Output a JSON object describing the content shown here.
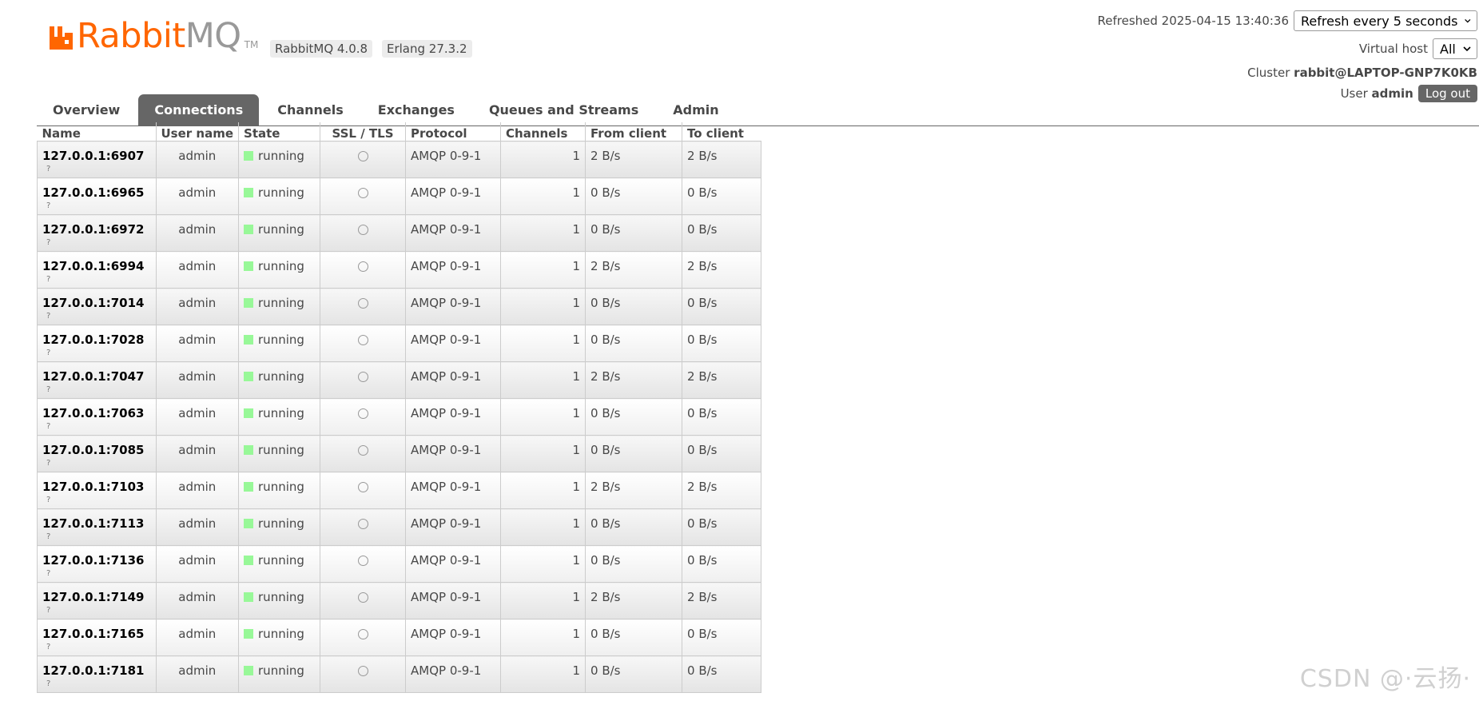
{
  "app": {
    "logo_rabbit": "Rabbit",
    "logo_mq": "MQ",
    "logo_tm": "TM",
    "version": "RabbitMQ 4.0.8",
    "erlang": "Erlang 27.3.2"
  },
  "status": {
    "refreshed": "Refreshed 2025-04-15 13:40:36",
    "refresh_select": "Refresh every 5 seconds",
    "vhost_label": "Virtual host",
    "vhost_select": "All",
    "cluster_label": "Cluster",
    "cluster_name": "rabbit@LAPTOP-GNP7K0KB",
    "user_label": "User",
    "user_name": "admin",
    "logout_label": "Log out"
  },
  "tabs": [
    {
      "label": "Overview",
      "active": false
    },
    {
      "label": "Connections",
      "active": true
    },
    {
      "label": "Channels",
      "active": false
    },
    {
      "label": "Exchanges",
      "active": false
    },
    {
      "label": "Queues and Streams",
      "active": false
    },
    {
      "label": "Admin",
      "active": false
    }
  ],
  "table": {
    "headers": {
      "name": "Name",
      "user": "User name",
      "state": "State",
      "ssl": "SSL / TLS",
      "protocol": "Protocol",
      "channels": "Channels",
      "from_client": "From client",
      "to_client": "To client"
    },
    "rows": [
      {
        "name": "127.0.0.1:6907",
        "sub": "?",
        "user": "admin",
        "state": "running",
        "protocol": "AMQP 0-9-1",
        "channels": "1",
        "from": "2 B/s",
        "to": "2 B/s"
      },
      {
        "name": "127.0.0.1:6965",
        "sub": "?",
        "user": "admin",
        "state": "running",
        "protocol": "AMQP 0-9-1",
        "channels": "1",
        "from": "0 B/s",
        "to": "0 B/s"
      },
      {
        "name": "127.0.0.1:6972",
        "sub": "?",
        "user": "admin",
        "state": "running",
        "protocol": "AMQP 0-9-1",
        "channels": "1",
        "from": "0 B/s",
        "to": "0 B/s"
      },
      {
        "name": "127.0.0.1:6994",
        "sub": "?",
        "user": "admin",
        "state": "running",
        "protocol": "AMQP 0-9-1",
        "channels": "1",
        "from": "2 B/s",
        "to": "2 B/s"
      },
      {
        "name": "127.0.0.1:7014",
        "sub": "?",
        "user": "admin",
        "state": "running",
        "protocol": "AMQP 0-9-1",
        "channels": "1",
        "from": "0 B/s",
        "to": "0 B/s"
      },
      {
        "name": "127.0.0.1:7028",
        "sub": "?",
        "user": "admin",
        "state": "running",
        "protocol": "AMQP 0-9-1",
        "channels": "1",
        "from": "0 B/s",
        "to": "0 B/s"
      },
      {
        "name": "127.0.0.1:7047",
        "sub": "?",
        "user": "admin",
        "state": "running",
        "protocol": "AMQP 0-9-1",
        "channels": "1",
        "from": "2 B/s",
        "to": "2 B/s"
      },
      {
        "name": "127.0.0.1:7063",
        "sub": "?",
        "user": "admin",
        "state": "running",
        "protocol": "AMQP 0-9-1",
        "channels": "1",
        "from": "0 B/s",
        "to": "0 B/s"
      },
      {
        "name": "127.0.0.1:7085",
        "sub": "?",
        "user": "admin",
        "state": "running",
        "protocol": "AMQP 0-9-1",
        "channels": "1",
        "from": "0 B/s",
        "to": "0 B/s"
      },
      {
        "name": "127.0.0.1:7103",
        "sub": "?",
        "user": "admin",
        "state": "running",
        "protocol": "AMQP 0-9-1",
        "channels": "1",
        "from": "2 B/s",
        "to": "2 B/s"
      },
      {
        "name": "127.0.0.1:7113",
        "sub": "?",
        "user": "admin",
        "state": "running",
        "protocol": "AMQP 0-9-1",
        "channels": "1",
        "from": "0 B/s",
        "to": "0 B/s"
      },
      {
        "name": "127.0.0.1:7136",
        "sub": "?",
        "user": "admin",
        "state": "running",
        "protocol": "AMQP 0-9-1",
        "channels": "1",
        "from": "0 B/s",
        "to": "0 B/s"
      },
      {
        "name": "127.0.0.1:7149",
        "sub": "?",
        "user": "admin",
        "state": "running",
        "protocol": "AMQP 0-9-1",
        "channels": "1",
        "from": "2 B/s",
        "to": "2 B/s"
      },
      {
        "name": "127.0.0.1:7165",
        "sub": "?",
        "user": "admin",
        "state": "running",
        "protocol": "AMQP 0-9-1",
        "channels": "1",
        "from": "0 B/s",
        "to": "0 B/s"
      },
      {
        "name": "127.0.0.1:7181",
        "sub": "?",
        "user": "admin",
        "state": "running",
        "protocol": "AMQP 0-9-1",
        "channels": "1",
        "from": "0 B/s",
        "to": "0 B/s"
      }
    ]
  },
  "colors": {
    "brand": "#ff6600",
    "running": "#98f898",
    "tab_active": "#666666"
  },
  "watermark": "CSDN @·云扬·"
}
